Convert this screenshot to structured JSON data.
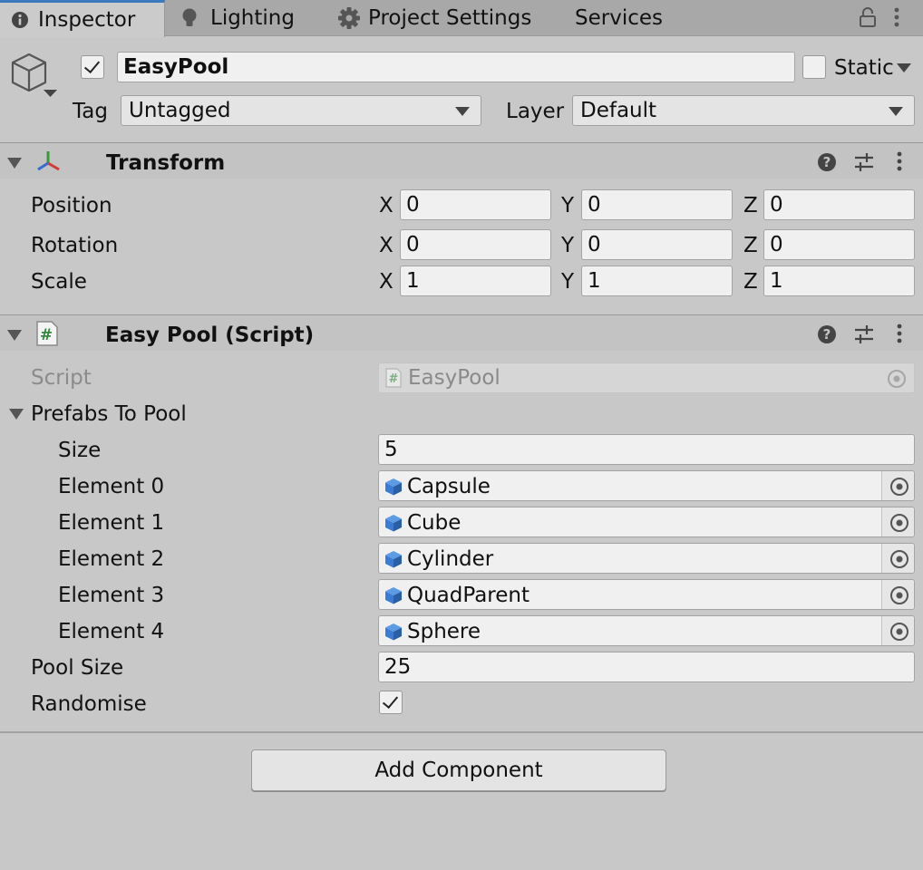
{
  "tabs": [
    {
      "label": "Inspector",
      "icon": "info-icon",
      "active": true
    },
    {
      "label": "Lighting",
      "icon": "lightbulb-icon",
      "active": false
    },
    {
      "label": "Project Settings",
      "icon": "gear-icon",
      "active": false
    },
    {
      "label": "Services",
      "active": false
    }
  ],
  "gameobject": {
    "active": true,
    "name": "EasyPool",
    "static_label": "Static",
    "static": false,
    "tag_label": "Tag",
    "tag_value": "Untagged",
    "layer_label": "Layer",
    "layer_value": "Default"
  },
  "transform": {
    "title": "Transform",
    "rows": [
      {
        "label": "Position",
        "x": "0",
        "y": "0",
        "z": "0"
      },
      {
        "label": "Rotation",
        "x": "0",
        "y": "0",
        "z": "0"
      },
      {
        "label": "Scale",
        "x": "1",
        "y": "1",
        "z": "1"
      }
    ],
    "axis": {
      "x": "X",
      "y": "Y",
      "z": "Z"
    }
  },
  "script_component": {
    "title": "Easy Pool (Script)",
    "script_label": "Script",
    "script_value": "EasyPool",
    "prefabs_label": "Prefabs To Pool",
    "size_label": "Size",
    "size_value": "5",
    "elements": [
      {
        "label": "Element 0",
        "value": "Capsule"
      },
      {
        "label": "Element 1",
        "value": "Cube"
      },
      {
        "label": "Element 2",
        "value": "Cylinder"
      },
      {
        "label": "Element 3",
        "value": "QuadParent"
      },
      {
        "label": "Element 4",
        "value": "Sphere"
      }
    ],
    "pool_size_label": "Pool Size",
    "pool_size_value": "25",
    "randomise_label": "Randomise",
    "randomise": true
  },
  "add_component_label": "Add Component",
  "colors": {
    "accent": "#3a79bb",
    "background": "#c8c8c8",
    "header": "#c3c3c3",
    "field": "#f0f0f0",
    "cube_icon": "#3b7bd1"
  }
}
